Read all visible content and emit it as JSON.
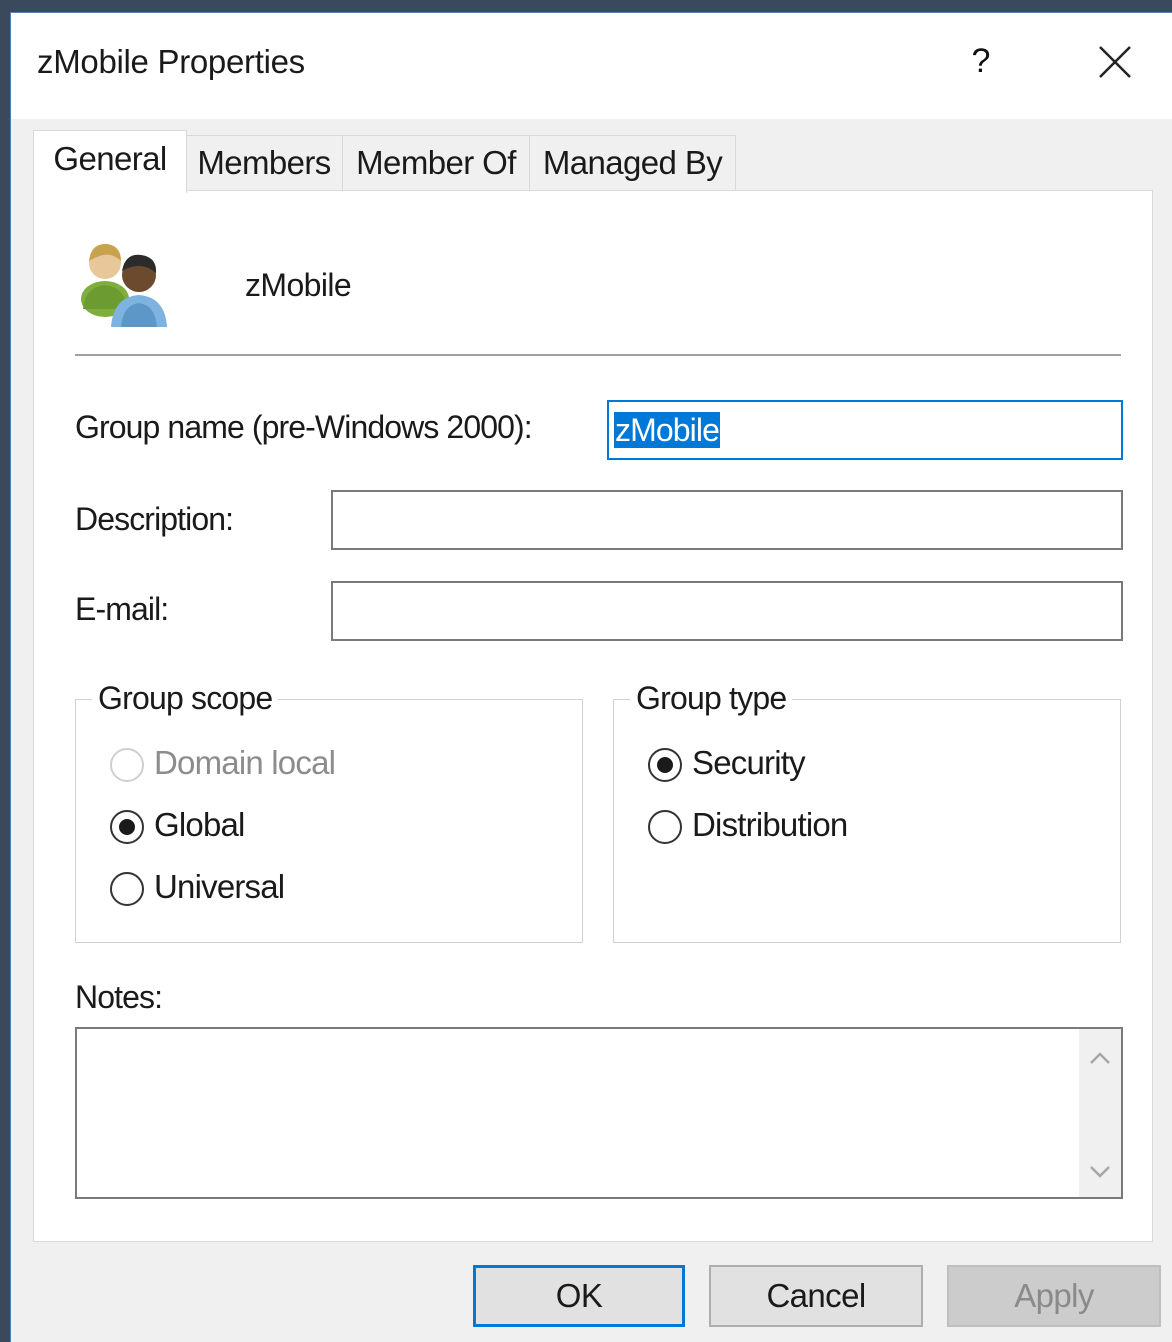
{
  "window": {
    "title": "zMobile Properties",
    "help_label": "?"
  },
  "tabs": [
    {
      "label": "General",
      "active": true
    },
    {
      "label": "Members",
      "active": false
    },
    {
      "label": "Member Of",
      "active": false
    },
    {
      "label": "Managed By",
      "active": false
    }
  ],
  "header": {
    "object_name": "zMobile",
    "icon": "group-users-icon"
  },
  "fields": {
    "group_name_label": "Group name (pre-Windows 2000):",
    "group_name_value": "zMobile",
    "description_label": "Description:",
    "description_value": "",
    "email_label": "E-mail:",
    "email_value": ""
  },
  "group_scope": {
    "title": "Group scope",
    "options": [
      {
        "label": "Domain local",
        "checked": false,
        "disabled": true
      },
      {
        "label": "Global",
        "checked": true,
        "disabled": false
      },
      {
        "label": "Universal",
        "checked": false,
        "disabled": false
      }
    ]
  },
  "group_type": {
    "title": "Group type",
    "options": [
      {
        "label": "Security",
        "checked": true
      },
      {
        "label": "Distribution",
        "checked": false
      }
    ]
  },
  "notes": {
    "label": "Notes:",
    "value": ""
  },
  "buttons": {
    "ok": "OK",
    "cancel": "Cancel",
    "apply": "Apply"
  },
  "colors": {
    "accent": "#0078d7",
    "dialog_bg": "#f0f0f0",
    "panel_bg": "#ffffff",
    "disabled_text": "#8c8c8c"
  }
}
